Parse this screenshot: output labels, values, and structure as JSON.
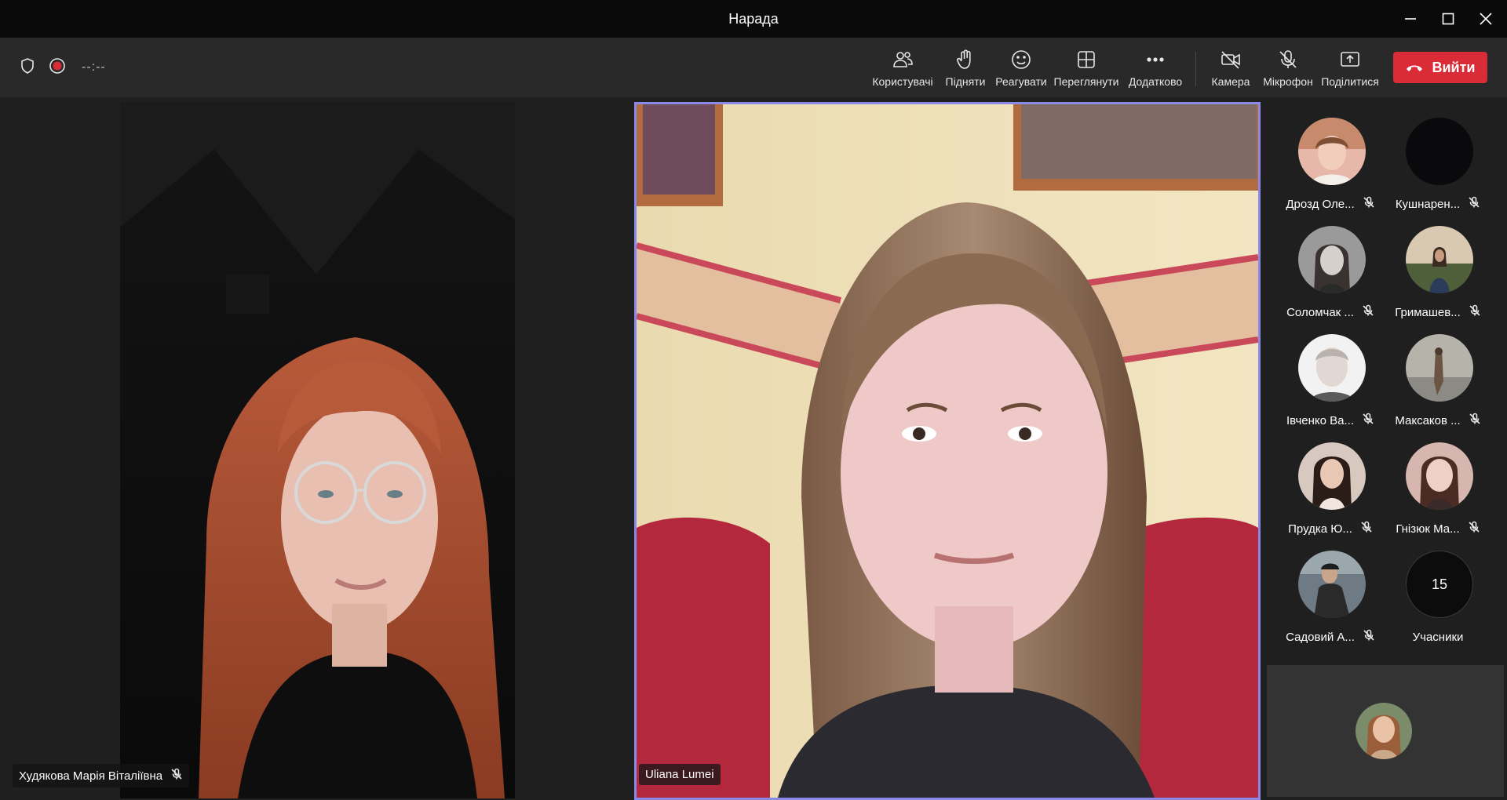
{
  "window": {
    "title": "Нарада"
  },
  "toolbar": {
    "timer": "--:--",
    "buttons": {
      "people": "Користувачі",
      "raise": "Підняти",
      "react": "Реагувати",
      "view": "Переглянути",
      "more": "Додатково",
      "camera": "Камера",
      "mic": "Мікрофон",
      "share": "Поділитися"
    },
    "leave_label": "Вийти",
    "leave_color": "#d92c37"
  },
  "stage": {
    "left_name": "Худякова Марія Віталіївна",
    "right_name": "Uliana Lumei",
    "active_border_color": "#8a89e8"
  },
  "roster": {
    "people": [
      {
        "name": "Дрозд Оле...",
        "muted": true
      },
      {
        "name": "Кушнарен...",
        "muted": true
      },
      {
        "name": "Соломчак ...",
        "muted": true
      },
      {
        "name": "Гримашев...",
        "muted": true
      },
      {
        "name": "Івченко Ва...",
        "muted": true
      },
      {
        "name": "Максаков ...",
        "muted": true
      },
      {
        "name": "Прудка Ю...",
        "muted": true
      },
      {
        "name": "Гнізюк Ма...",
        "muted": true
      },
      {
        "name": "Садовий А...",
        "muted": true
      }
    ],
    "more_count": "15",
    "more_label": "Учасники"
  }
}
